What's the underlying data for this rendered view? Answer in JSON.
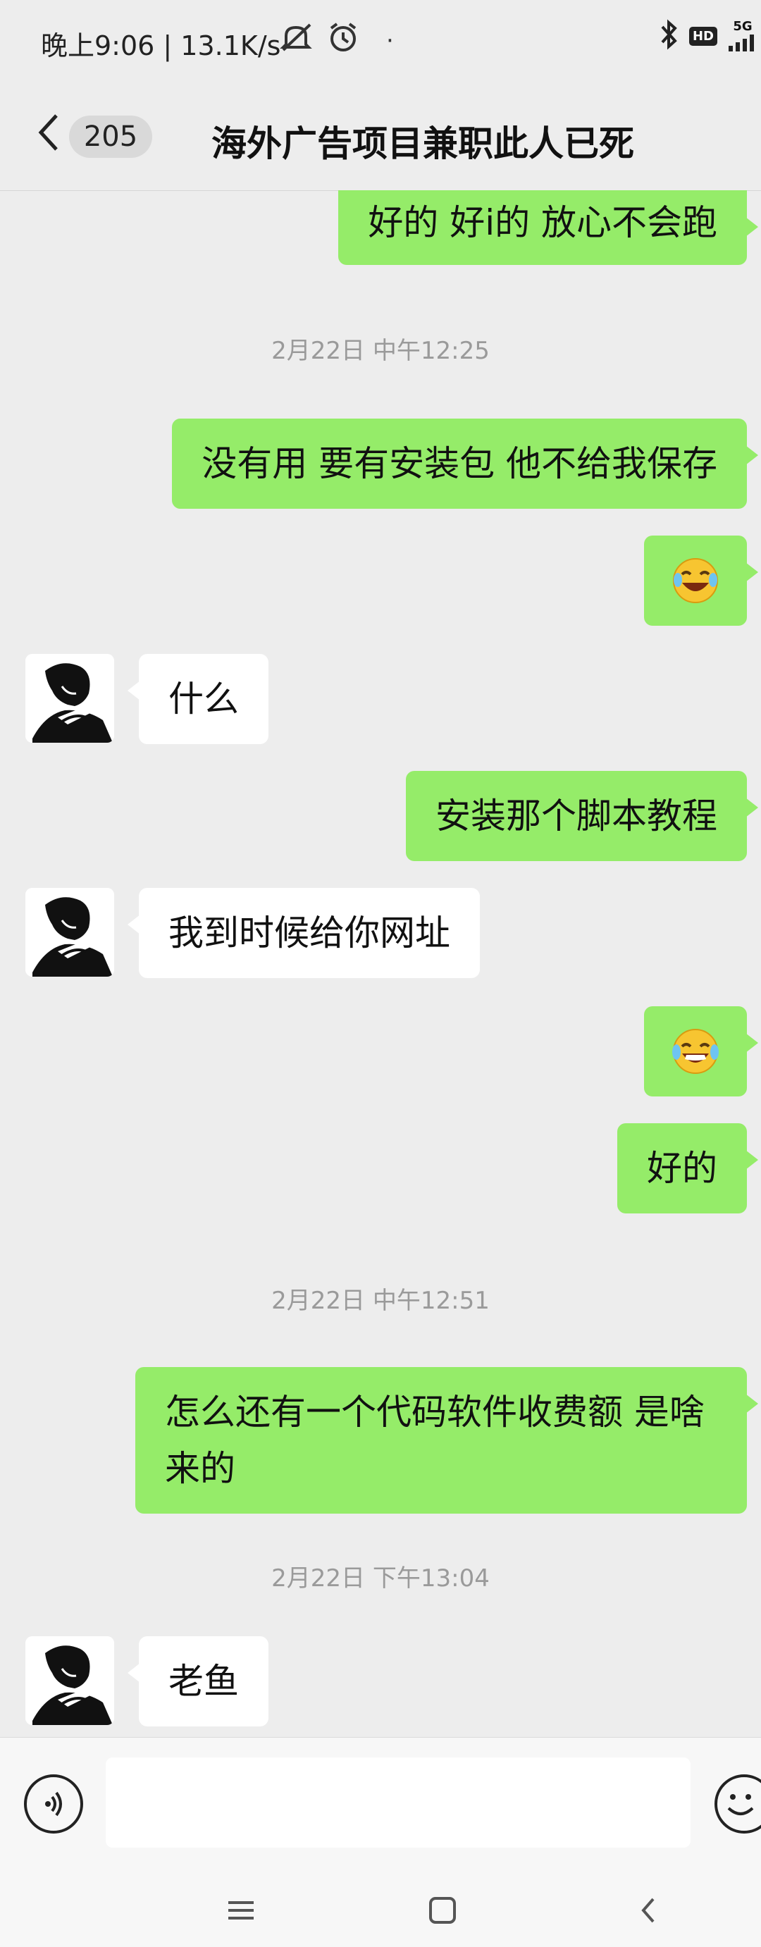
{
  "status_bar": {
    "time_speed": "晚上9:06 | 13.1K/s",
    "dot": "·",
    "hd": "HD",
    "network": "5G"
  },
  "header": {
    "unread_count": "205",
    "title": "海外广告项目兼职此人已死"
  },
  "messages": {
    "m1": "好的 好i的 放心不会跑",
    "t1": "2月22日 中午12:25",
    "m2": "没有用 要有安装包 他不给我保存",
    "m4": "什么",
    "m5": "安装那个脚本教程",
    "m6": "我到时候给你网址",
    "m8": "好的",
    "t2": "2月22日 中午12:51",
    "m9": "怎么还有一个代码软件收费额 是啥来的",
    "t3": "2月22日 下午13:04",
    "m10": "老鱼"
  },
  "input": {
    "placeholder": ""
  },
  "colors": {
    "out_bubble": "#95ec69",
    "in_bubble": "#ffffff",
    "background": "#ededed"
  }
}
